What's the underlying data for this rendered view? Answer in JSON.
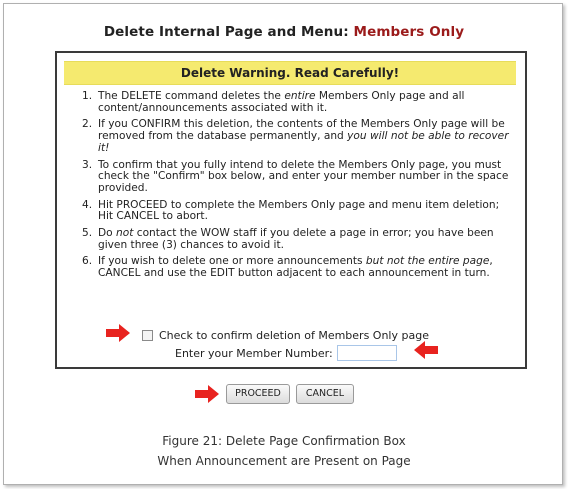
{
  "heading": {
    "prefix": "Delete Internal Page and Menu: ",
    "page_name": "Members Only"
  },
  "dialog": {
    "warning": "Delete Warning. Read Carefully!",
    "items": [
      {
        "num": "1.",
        "parts": [
          {
            "text": "The DELETE command deletes the ",
            "italic": false
          },
          {
            "text": "entire",
            "italic": true
          },
          {
            "text": " Members Only page and all content/announcements associated with it.",
            "italic": false
          }
        ]
      },
      {
        "num": "2.",
        "parts": [
          {
            "text": "If you CONFIRM this deletion, the contents of the Members Only page will be removed from the database permanently, and ",
            "italic": false
          },
          {
            "text": "you will not be able to recover it!",
            "italic": true
          }
        ]
      },
      {
        "num": "3.",
        "parts": [
          {
            "text": "To confirm that you fully intend to delete the Members Only page, you must check the \"Confirm\" box below, and enter your member number in the space provided.",
            "italic": false
          }
        ]
      },
      {
        "num": "4.",
        "parts": [
          {
            "text": "Hit PROCEED to complete the Members Only page and menu item deletion; Hit CANCEL to abort.",
            "italic": false
          }
        ]
      },
      {
        "num": "5.",
        "parts": [
          {
            "text": "Do ",
            "italic": false
          },
          {
            "text": "not",
            "italic": true
          },
          {
            "text": " contact the WOW staff if you delete a page in error; you have been given three (3) chances to avoid it.",
            "italic": false
          }
        ]
      },
      {
        "num": "6.",
        "parts": [
          {
            "text": "If you wish to delete one or more announcements ",
            "italic": false
          },
          {
            "text": "but not the entire page",
            "italic": true
          },
          {
            "text": ", CANCEL and use the EDIT button adjacent to each announcement in turn.",
            "italic": false
          }
        ]
      }
    ],
    "confirm_label": "Check to confirm deletion of Members Only page",
    "member_label": "Enter your Member Number:",
    "member_value": ""
  },
  "buttons": {
    "proceed": "PROCEED",
    "cancel": "CANCEL"
  },
  "caption": {
    "line1": "Figure 21: Delete Page Confirmation Box",
    "line2": "When Announcement are Present on Page"
  },
  "colors": {
    "accent": "#9b1b1b",
    "banner": "#f5ea6f",
    "arrow": "#e8231f"
  },
  "icons": [
    "right-arrow-icon",
    "left-arrow-icon"
  ]
}
